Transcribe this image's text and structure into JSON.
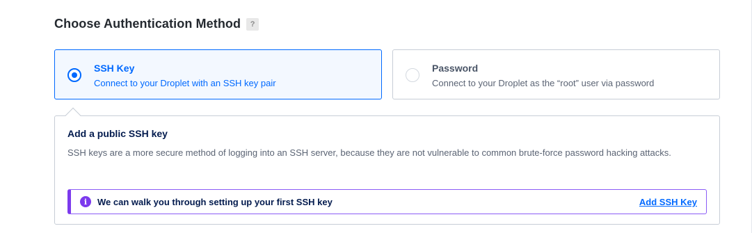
{
  "section": {
    "title": "Choose Authentication Method",
    "help_label": "?"
  },
  "options": [
    {
      "title": "SSH Key",
      "description": "Connect to your Droplet with an SSH key pair",
      "selected": true
    },
    {
      "title": "Password",
      "description": "Connect to your Droplet as the “root” user via password",
      "selected": false
    }
  ],
  "panel": {
    "title": "Add a public SSH key",
    "description": "SSH keys are a more secure method of logging into an SSH server, because they are not vulnerable to common brute-force password hacking attacks.",
    "notice": {
      "icon": "info-icon",
      "icon_glyph": "i",
      "text": "We can walk you through setting up your first SSH key",
      "link_label": "Add SSH Key"
    }
  },
  "colors": {
    "accent": "#0069ff",
    "notice_accent": "#7c3aed"
  }
}
